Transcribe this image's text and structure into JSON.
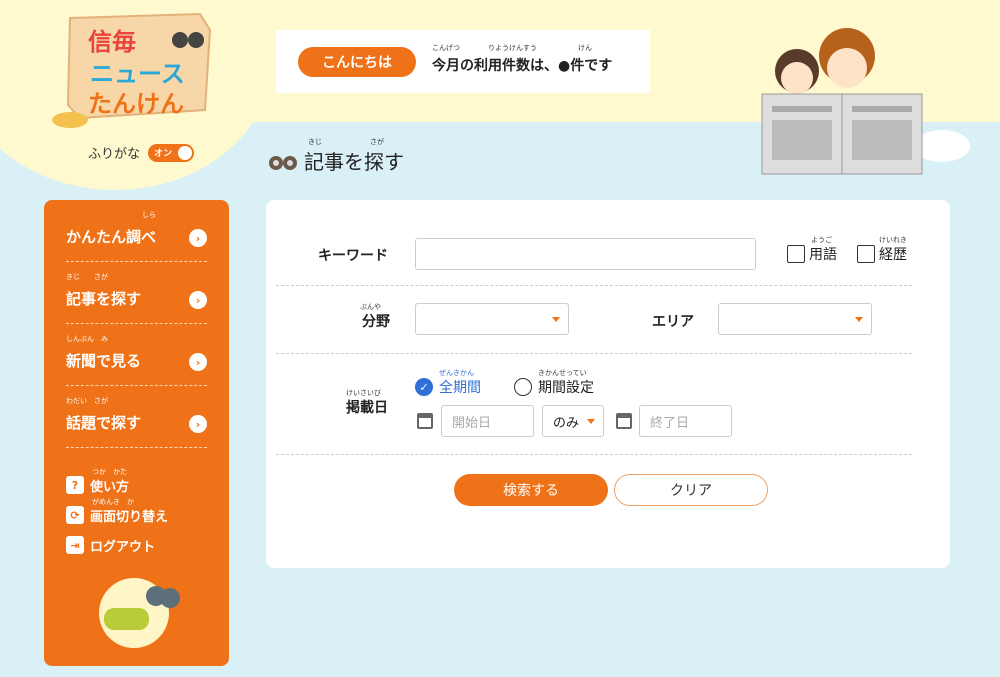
{
  "header": {
    "logo": {
      "line1": "信毎",
      "line2": "ニュース",
      "line3": "たんけん"
    },
    "furigana_label": "ふりがな",
    "furigana_toggle": "オン",
    "greeting_button": "こんにちは",
    "usage_text": "今月の利用件数は、●件です",
    "usage_ruby": {
      "kongetsu": "こんげつ",
      "riyoukensuu": "りようけんすう",
      "ken": "けん"
    }
  },
  "page": {
    "title": "記事を探す",
    "title_ruby": {
      "kiji": "きじ",
      "sagasu": "さが"
    }
  },
  "sidebar": {
    "items": [
      {
        "label": "かんたん調べ",
        "ruby": "しら"
      },
      {
        "label": "記事を探す",
        "ruby": "きじ　　さが"
      },
      {
        "label": "新聞で見る",
        "ruby": "しんぶん　み"
      },
      {
        "label": "話題で探す",
        "ruby": "わだい　さが"
      }
    ],
    "utilities": [
      {
        "label": "使い方",
        "ruby": "つか　かた",
        "icon": "?"
      },
      {
        "label": "画面切り替え",
        "ruby": "がめんき　か",
        "icon": "⟳"
      },
      {
        "label": "ログアウト",
        "ruby": "",
        "icon": "⇥"
      }
    ]
  },
  "form": {
    "keyword_label": "キーワード",
    "keyword_value": "",
    "terms_label": "用語",
    "terms_ruby": "ようご",
    "career_label": "経歴",
    "career_ruby": "けいれき",
    "field_label": "分野",
    "field_ruby": "ぶんや",
    "field_value": "",
    "area_label": "エリア",
    "area_value": "",
    "period_label": "掲載日",
    "period_ruby": "けいさいび",
    "all_period": "全期間",
    "all_period_ruby": "ぜんきかん",
    "set_period": "期間設定",
    "set_period_ruby": "きかんせってい",
    "start_placeholder": "開始日",
    "range_mode": "のみ",
    "end_placeholder": "終了日",
    "search_button": "検索する",
    "clear_button": "クリア"
  },
  "colors": {
    "accent": "#ef7218",
    "background": "#d9f0f7",
    "header_band": "#fff9cf",
    "radio_selected": "#2f6fd6"
  }
}
